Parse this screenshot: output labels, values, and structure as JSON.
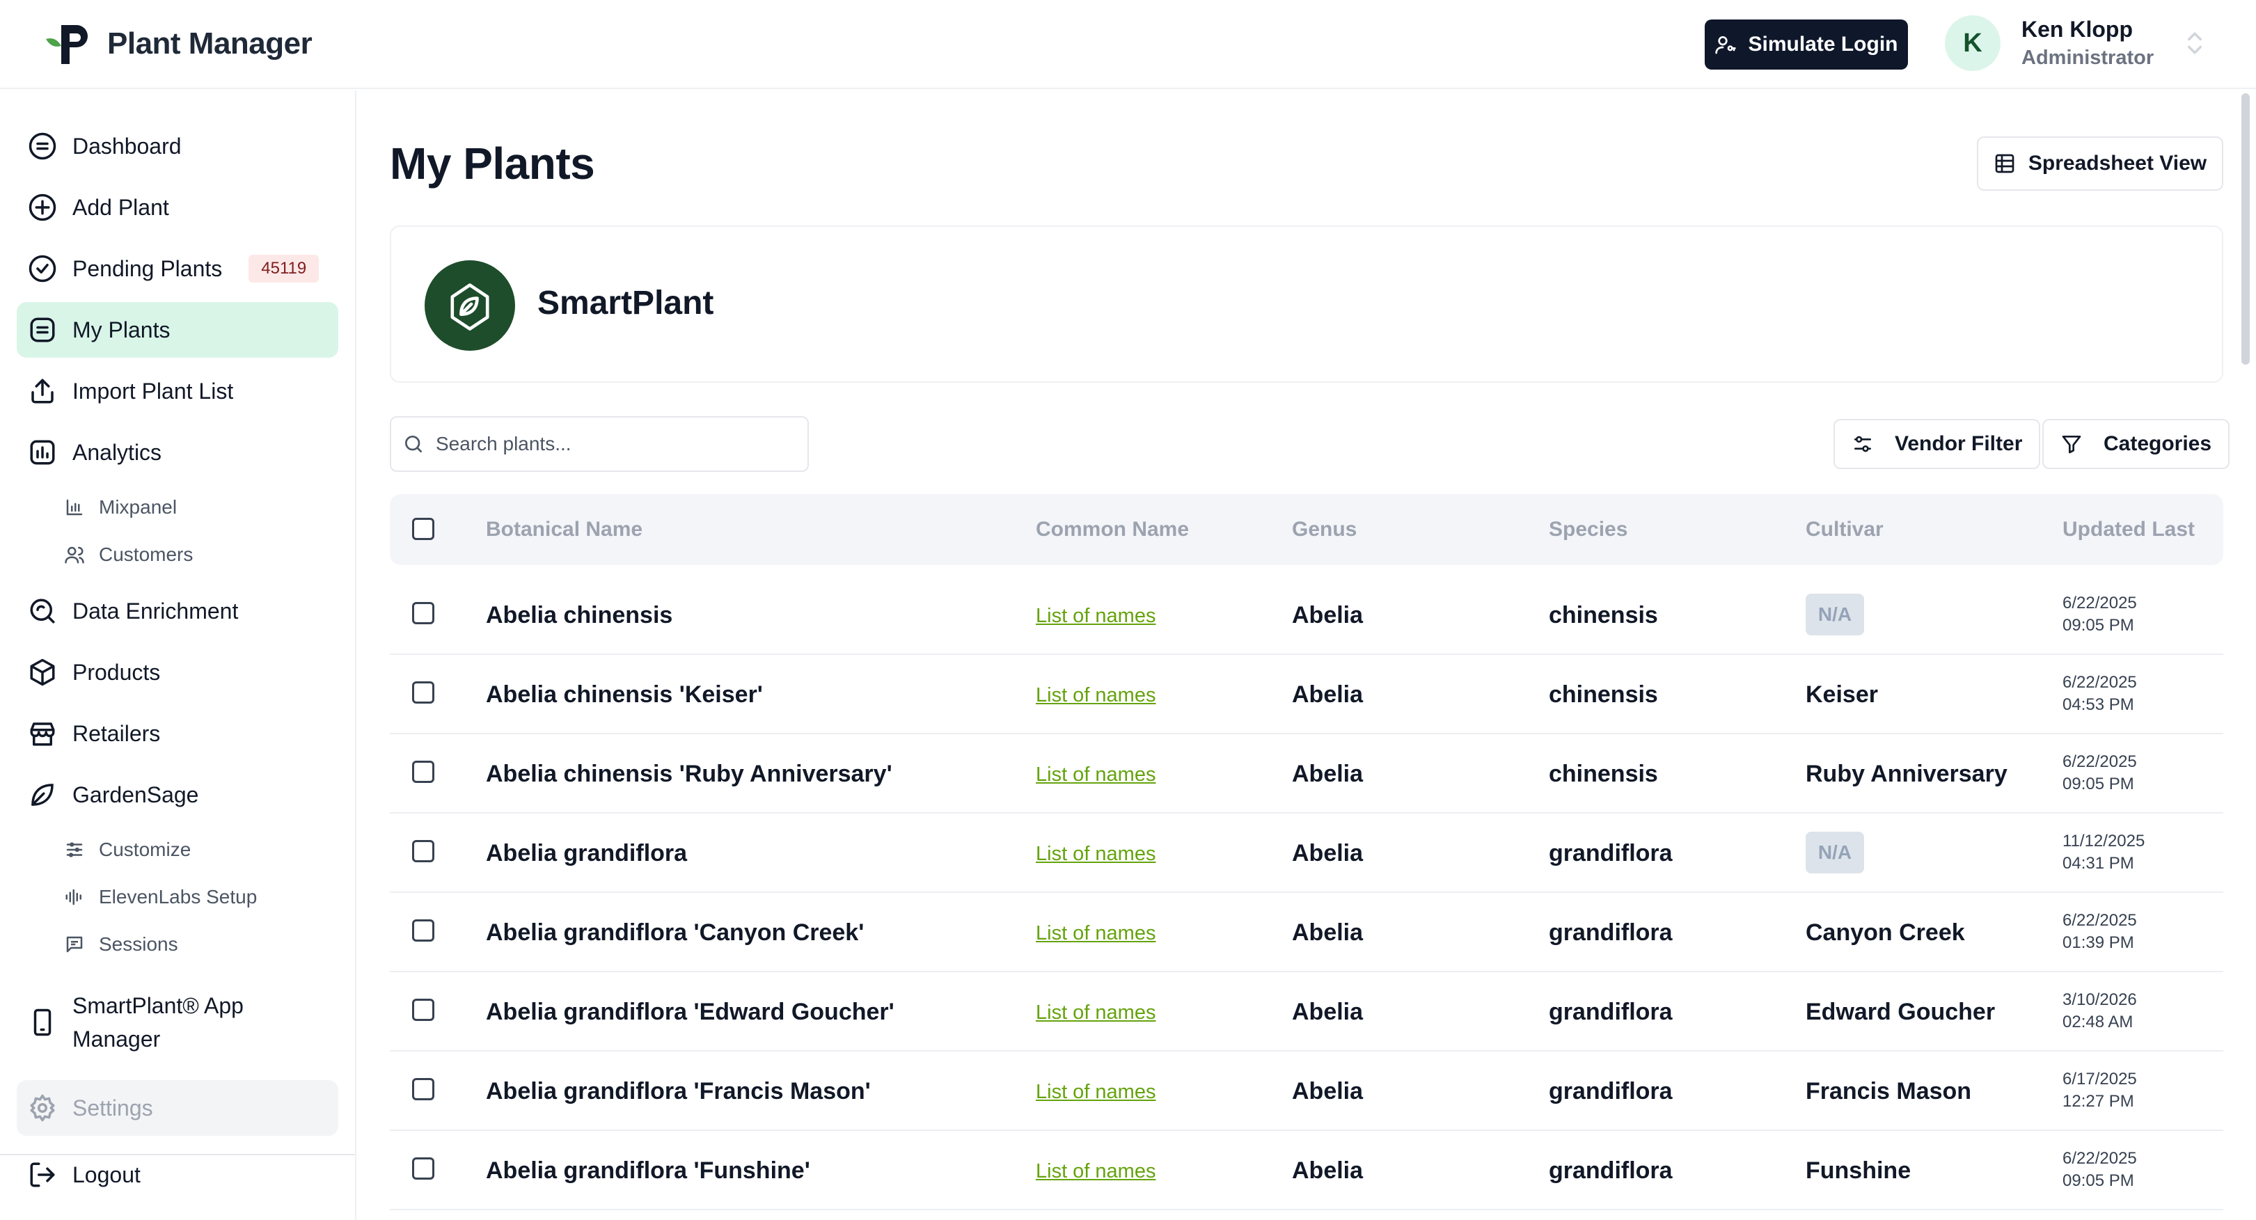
{
  "app": {
    "name": "Plant Manager",
    "simulate_login": "Simulate Login",
    "user": {
      "initial": "K",
      "name": "Ken Klopp",
      "role": "Administrator"
    }
  },
  "sidebar": {
    "items": [
      {
        "label": "Dashboard",
        "icon": "dashboard-icon"
      },
      {
        "label": "Add Plant",
        "icon": "plus-circle-icon"
      },
      {
        "label": "Pending Plants",
        "icon": "check-circle-icon",
        "badge": "45119"
      },
      {
        "label": "My Plants",
        "icon": "list-icon",
        "active": true
      },
      {
        "label": "Import Plant List",
        "icon": "upload-icon"
      },
      {
        "label": "Analytics",
        "icon": "chart-icon"
      },
      {
        "label": "Data Enrichment",
        "icon": "search-refresh-icon"
      },
      {
        "label": "Products",
        "icon": "box-icon"
      },
      {
        "label": "Retailers",
        "icon": "store-icon"
      },
      {
        "label": "GardenSage",
        "icon": "leaf-icon"
      },
      {
        "label_line1": "SmartPlant® App",
        "label_line2": "Manager",
        "icon": "phone-icon"
      },
      {
        "label": "Settings",
        "icon": "gear-icon"
      },
      {
        "label": "Logout",
        "icon": "logout-icon"
      }
    ],
    "analytics_sub": [
      {
        "label": "Mixpanel",
        "icon": "bar-chart-icon"
      },
      {
        "label": "Customers",
        "icon": "users-icon"
      }
    ],
    "gardensage_sub": [
      {
        "label": "Customize",
        "icon": "sliders-icon"
      },
      {
        "label": "ElevenLabs Setup",
        "icon": "audio-wave-icon"
      },
      {
        "label": "Sessions",
        "icon": "message-icon"
      }
    ]
  },
  "main": {
    "title": "My Plants",
    "spreadsheet_view": "Spreadsheet View",
    "org_name": "SmartPlant",
    "search_placeholder": "Search plants...",
    "vendor_filter": "Vendor Filter",
    "categories": "Categories"
  },
  "table": {
    "headers": [
      "Botanical Name",
      "Common Name",
      "Genus",
      "Species",
      "Cultivar",
      "Updated Last"
    ],
    "rows": [
      {
        "botanical": "Abelia chinensis",
        "common": "List of names",
        "genus": "Abelia",
        "species": "chinensis",
        "cultivar": "N/A",
        "cultivar_na": true,
        "date": "6/22/2025",
        "time": "09:05 PM"
      },
      {
        "botanical": "Abelia chinensis 'Keiser'",
        "common": "List of names",
        "genus": "Abelia",
        "species": "chinensis",
        "cultivar": "Keiser",
        "cultivar_na": false,
        "date": "6/22/2025",
        "time": "04:53 PM"
      },
      {
        "botanical": "Abelia chinensis 'Ruby Anniversary'",
        "common": "List of names",
        "genus": "Abelia",
        "species": "chinensis",
        "cultivar": "Ruby Anniversary",
        "cultivar_na": false,
        "date": "6/22/2025",
        "time": "09:05 PM"
      },
      {
        "botanical": "Abelia grandiflora",
        "common": "List of names",
        "genus": "Abelia",
        "species": "grandiflora",
        "cultivar": "N/A",
        "cultivar_na": true,
        "date": "11/12/2025",
        "time": "04:31 PM"
      },
      {
        "botanical": "Abelia grandiflora 'Canyon Creek'",
        "common": "List of names",
        "genus": "Abelia",
        "species": "grandiflora",
        "cultivar": "Canyon Creek",
        "cultivar_na": false,
        "date": "6/22/2025",
        "time": "01:39 PM"
      },
      {
        "botanical": "Abelia grandiflora 'Edward Goucher'",
        "common": "List of names",
        "genus": "Abelia",
        "species": "grandiflora",
        "cultivar": "Edward Goucher",
        "cultivar_na": false,
        "date": "3/10/2026",
        "time": "02:48 AM"
      },
      {
        "botanical": "Abelia grandiflora 'Francis Mason'",
        "common": "List of names",
        "genus": "Abelia",
        "species": "grandiflora",
        "cultivar": "Francis Mason",
        "cultivar_na": false,
        "date": "6/17/2025",
        "time": "12:27 PM"
      },
      {
        "botanical": "Abelia grandiflora 'Funshine'",
        "common": "List of names",
        "genus": "Abelia",
        "species": "grandiflora",
        "cultivar": "Funshine",
        "cultivar_na": false,
        "date": "6/22/2025",
        "time": "09:05 PM"
      }
    ]
  },
  "colors": {
    "brand_dark_green": "#1e4d2b",
    "active_nav_bg": "#d9f5e8",
    "link_green": "#65a30d",
    "primary_button": "#0f172a"
  }
}
